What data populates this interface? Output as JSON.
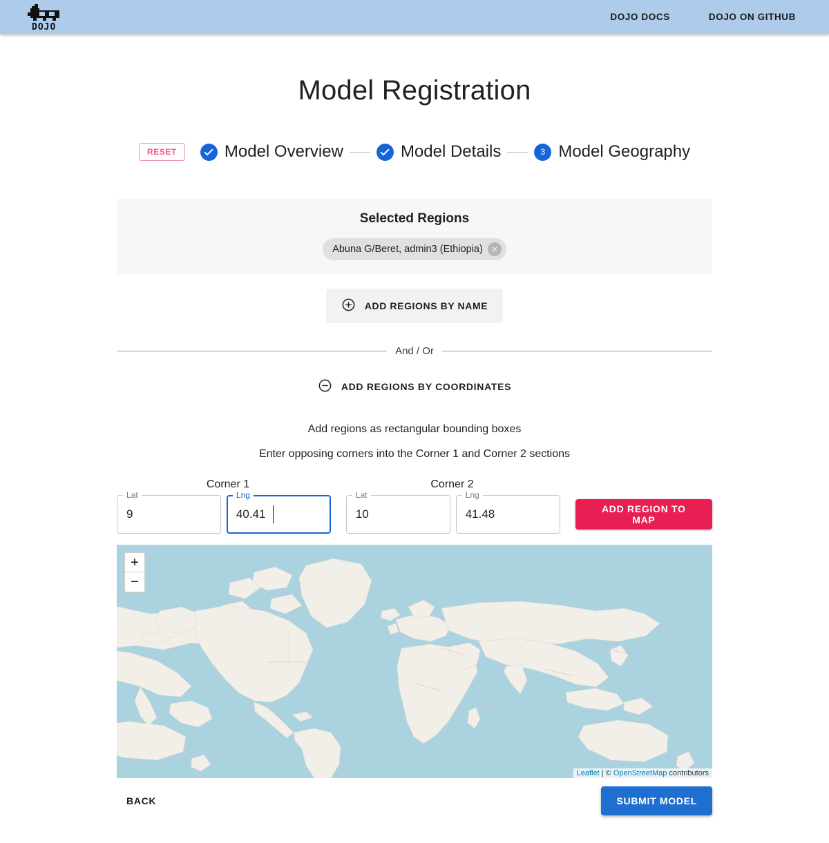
{
  "header": {
    "logo_text": "DOJO",
    "logo_icon": "dojo-cow-logo",
    "nav": [
      {
        "label": "DOJO DOCS",
        "name": "nav-link-dojo-docs"
      },
      {
        "label": "DOJO ON GITHUB",
        "name": "nav-link-dojo-github"
      }
    ],
    "bar_color": "#aecbeb"
  },
  "page": {
    "title": "Model Registration"
  },
  "stepper": {
    "reset_label": "RESET",
    "reset_color": "#ef5b8c",
    "active_color": "#1565d8",
    "steps": [
      {
        "label": "Model Overview",
        "number": "1",
        "state": "completed",
        "marker": "check-icon"
      },
      {
        "label": "Model Details",
        "number": "2",
        "state": "completed",
        "marker": "check-icon"
      },
      {
        "label": "Model Geography",
        "number": "3",
        "state": "active",
        "marker": "3"
      }
    ]
  },
  "selected_regions": {
    "heading": "Selected Regions",
    "chips": [
      {
        "label": "Abuna G/Beret, admin3 (Ethiopia)",
        "delete_icon": "close-circle-icon"
      }
    ]
  },
  "add_by_name": {
    "label": "ADD REGIONS BY NAME",
    "icon": "plus-circle-icon"
  },
  "divider": {
    "label": "And / Or"
  },
  "add_by_coordinates": {
    "label": "ADD REGIONS BY COORDINATES",
    "icon": "minus-circle-icon",
    "expanded": true,
    "helper_line_1": "Add regions as rectangular bounding boxes",
    "helper_line_2": "Enter opposing corners into the Corner 1 and Corner 2 sections",
    "corner1": {
      "title": "Corner 1",
      "lat": {
        "legend": "Lat",
        "value": "9",
        "focused": false
      },
      "lng": {
        "legend": "Lng",
        "value": "40.41",
        "focused": true
      }
    },
    "corner2": {
      "title": "Corner 2",
      "lat": {
        "legend": "Lat",
        "value": "10",
        "focused": false
      },
      "lng": {
        "legend": "Lng",
        "value": "41.48",
        "focused": false
      }
    },
    "add_region_button": {
      "label": "ADD REGION TO MAP",
      "color": "#e91e52"
    }
  },
  "map": {
    "zoom_in_label": "+",
    "zoom_out_label": "−",
    "ocean_color": "#aad3df",
    "land_color": "#f2efe9",
    "border_color": "#d9c6c6",
    "attribution": {
      "leaflet": "Leaflet",
      "separator": " | ",
      "copyright": "© ",
      "osm": "OpenStreetMap",
      "suffix": " contributors"
    }
  },
  "footer": {
    "back_label": "BACK",
    "submit_label": "SUBMIT MODEL",
    "submit_color": "#1f6fd0"
  }
}
